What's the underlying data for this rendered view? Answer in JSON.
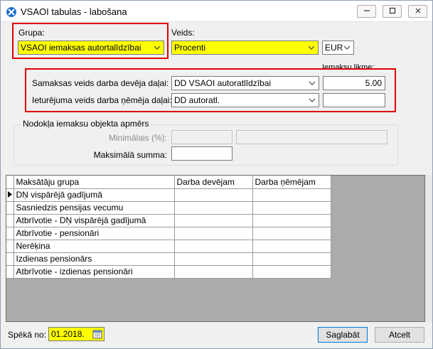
{
  "window": {
    "title": "VSAOI tabulas - labošana"
  },
  "group": {
    "label": "Grupa:",
    "value": "VSAOI iemaksas autortalīdzībai"
  },
  "type": {
    "label": "Veids:",
    "value": "Procenti"
  },
  "currency": {
    "value": "EUR"
  },
  "rate_header": "Iemaksu likme:",
  "employer_method": {
    "label": "Samaksas veids darba devēja daļai:",
    "value": "DD VSAOI autoratlīdzībai",
    "rate": "5.00"
  },
  "employee_method": {
    "label": "Ieturējuma veids darba ņēmēja daļai:",
    "value": "DD autoratl.",
    "rate": ""
  },
  "base_group": {
    "legend": "Nodokļa iemaksu objekta apmērs",
    "min_label": "Minimālais (%):",
    "min_value": "",
    "min_extra": "",
    "max_label": "Maksimālā summa:",
    "max_value": ""
  },
  "table": {
    "columns": [
      "Maksātāju grupa",
      "Darba devējam",
      "Darba ņēmējam"
    ],
    "rows": [
      [
        "DŅ vispārējā gadījumā",
        "",
        ""
      ],
      [
        "Sasniedzis pensijas vecumu",
        "",
        ""
      ],
      [
        "Atbrīvotie - DŅ vispārējā gadījumā",
        "",
        ""
      ],
      [
        "Atbrīvotie - pensionāri",
        "",
        ""
      ],
      [
        "Nerēķina",
        "",
        ""
      ],
      [
        "Izdienas pensionārs",
        "",
        ""
      ],
      [
        "Atbrīvotie - izdienas pensionāri",
        "",
        ""
      ]
    ]
  },
  "footer": {
    "effective_label": "Spēkā no:",
    "effective_value": "01.2018.",
    "save_label": "Saglabāt",
    "cancel_label": "Atcelt"
  },
  "icons": {
    "app": "app-logo-icon",
    "minimize": "minimize-icon",
    "maximize": "maximize-icon",
    "close": "close-icon",
    "dropdown": "chevron-down-icon",
    "calendar": "calendar-icon",
    "row_pointer": "row-pointer-icon"
  },
  "colors": {
    "highlight": "#ffff00",
    "annotation_red": "#e00000",
    "accent": "#0078d7"
  }
}
